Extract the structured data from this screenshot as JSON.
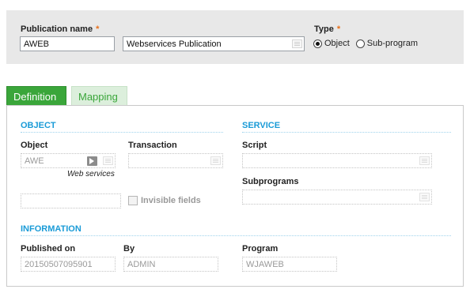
{
  "header": {
    "publication_name_label": "Publication name",
    "required_mark": "*",
    "publication_code": "AWEB",
    "publication_title": "Webservices Publication",
    "type_label": "Type",
    "type_options": [
      "Object",
      "Sub-program"
    ],
    "type_selected": "Object"
  },
  "tabs": [
    {
      "label": "Definition",
      "active": true
    },
    {
      "label": "Mapping",
      "active": false
    }
  ],
  "object_section": {
    "title": "OBJECT",
    "object_label": "Object",
    "object_value": "AWE",
    "web_services_link": "Web services",
    "transaction_label": "Transaction",
    "transaction_value": "",
    "extra_value": "",
    "invisible_fields_label": "Invisible fields",
    "invisible_fields_checked": false
  },
  "service_section": {
    "title": "SERVICE",
    "script_label": "Script",
    "script_value": "",
    "subprograms_label": "Subprograms",
    "subprograms_value": ""
  },
  "information_section": {
    "title": "INFORMATION",
    "published_on_label": "Published on",
    "published_on_value": "20150507095901",
    "by_label": "By",
    "by_value": "ADMIN",
    "program_label": "Program",
    "program_value": "WJAWEB"
  },
  "colors": {
    "accent_green": "#3aa63a",
    "section_blue": "#1a9bd7",
    "required_orange": "#e8701a",
    "header_bg": "#e8e8e8"
  }
}
